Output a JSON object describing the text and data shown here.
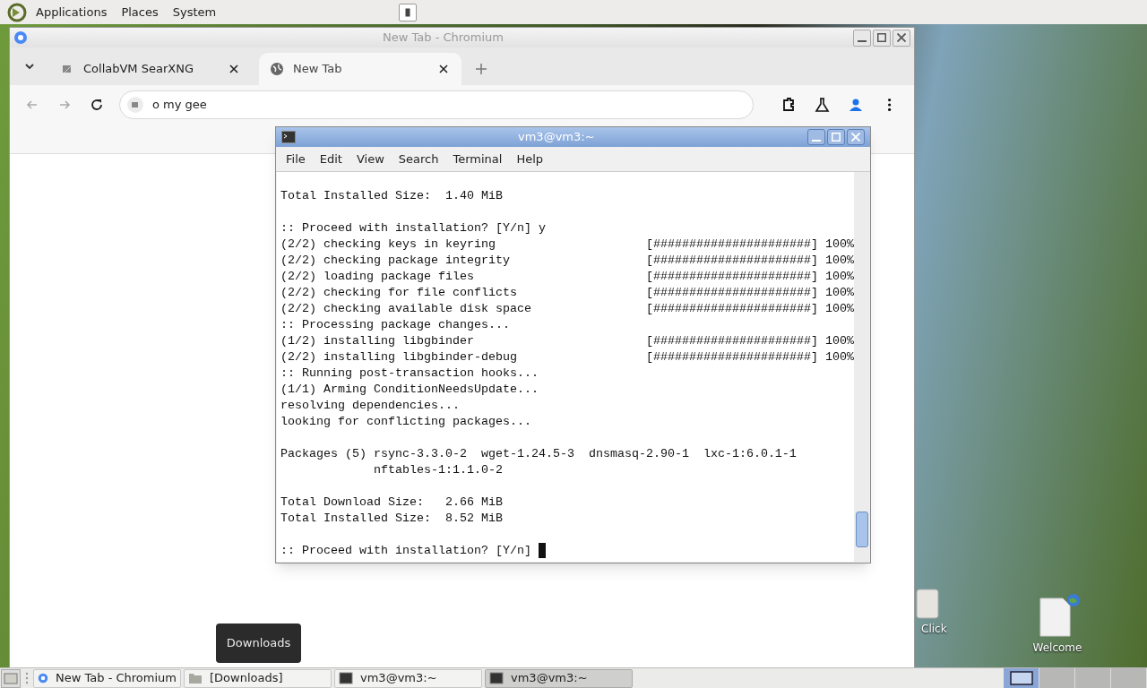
{
  "top_panel": {
    "menus": [
      "Applications",
      "Places",
      "System"
    ]
  },
  "browser": {
    "title": "New Tab - Chromium",
    "tabs": [
      {
        "label": "CollabVM SearXNG",
        "selected": false,
        "kind": "site"
      },
      {
        "label": "New Tab",
        "selected": true,
        "kind": "globe"
      }
    ],
    "omnibox": {
      "value": "o my gee"
    }
  },
  "terminal": {
    "title": "vm3@vm3:~",
    "menu": [
      "File",
      "Edit",
      "View",
      "Search",
      "Terminal",
      "Help"
    ],
    "blocks": [
      [
        {
          "text": "Total Installed Size:  1.40 MiB"
        }
      ],
      [
        {
          "text": ":: Proceed with installation? [Y/n] y"
        },
        {
          "text": "(2/2) checking keys in keyring",
          "bar": "[######################]",
          "percent": "100%"
        },
        {
          "text": "(2/2) checking package integrity",
          "bar": "[######################]",
          "percent": "100%"
        },
        {
          "text": "(2/2) loading package files",
          "bar": "[######################]",
          "percent": "100%"
        },
        {
          "text": "(2/2) checking for file conflicts",
          "bar": "[######################]",
          "percent": "100%"
        },
        {
          "text": "(2/2) checking available disk space",
          "bar": "[######################]",
          "percent": "100%"
        },
        {
          "text": ":: Processing package changes..."
        },
        {
          "text": "(1/2) installing libgbinder",
          "bar": "[######################]",
          "percent": "100%"
        },
        {
          "text": "(2/2) installing libgbinder-debug",
          "bar": "[######################]",
          "percent": "100%"
        },
        {
          "text": ":: Running post-transaction hooks..."
        },
        {
          "text": "(1/1) Arming ConditionNeedsUpdate..."
        },
        {
          "text": "resolving dependencies..."
        },
        {
          "text": "looking for conflicting packages..."
        }
      ],
      [
        {
          "text": "Packages (5) rsync-3.3.0-2  wget-1.24.5-3  dnsmasq-2.90-1  lxc-1:6.0.1-1"
        },
        {
          "text": "             nftables-1:1.1.0-2"
        }
      ],
      [
        {
          "text": "Total Download Size:   2.66 MiB"
        },
        {
          "text": "Total Installed Size:  8.52 MiB"
        }
      ],
      [
        {
          "text": ":: Proceed with installation? [Y/n] ",
          "cursor": true
        }
      ]
    ]
  },
  "desktop_icons": [
    {
      "label": "Click",
      "kind": "drive"
    },
    {
      "label": "Welcome",
      "kind": "file"
    }
  ],
  "tooltip": "Downloads",
  "taskbar": {
    "items": [
      {
        "label": "New Tab - Chromium",
        "kind": "chromium",
        "selected": false
      },
      {
        "label": "[Downloads]",
        "kind": "folder",
        "selected": false
      },
      {
        "label": "vm3@vm3:~",
        "kind": "terminal",
        "selected": false
      },
      {
        "label": "vm3@vm3:~",
        "kind": "terminal",
        "selected": true
      }
    ],
    "workspaces": [
      {
        "selected": true
      },
      {
        "selected": false
      },
      {
        "selected": false
      },
      {
        "selected": false
      }
    ]
  }
}
